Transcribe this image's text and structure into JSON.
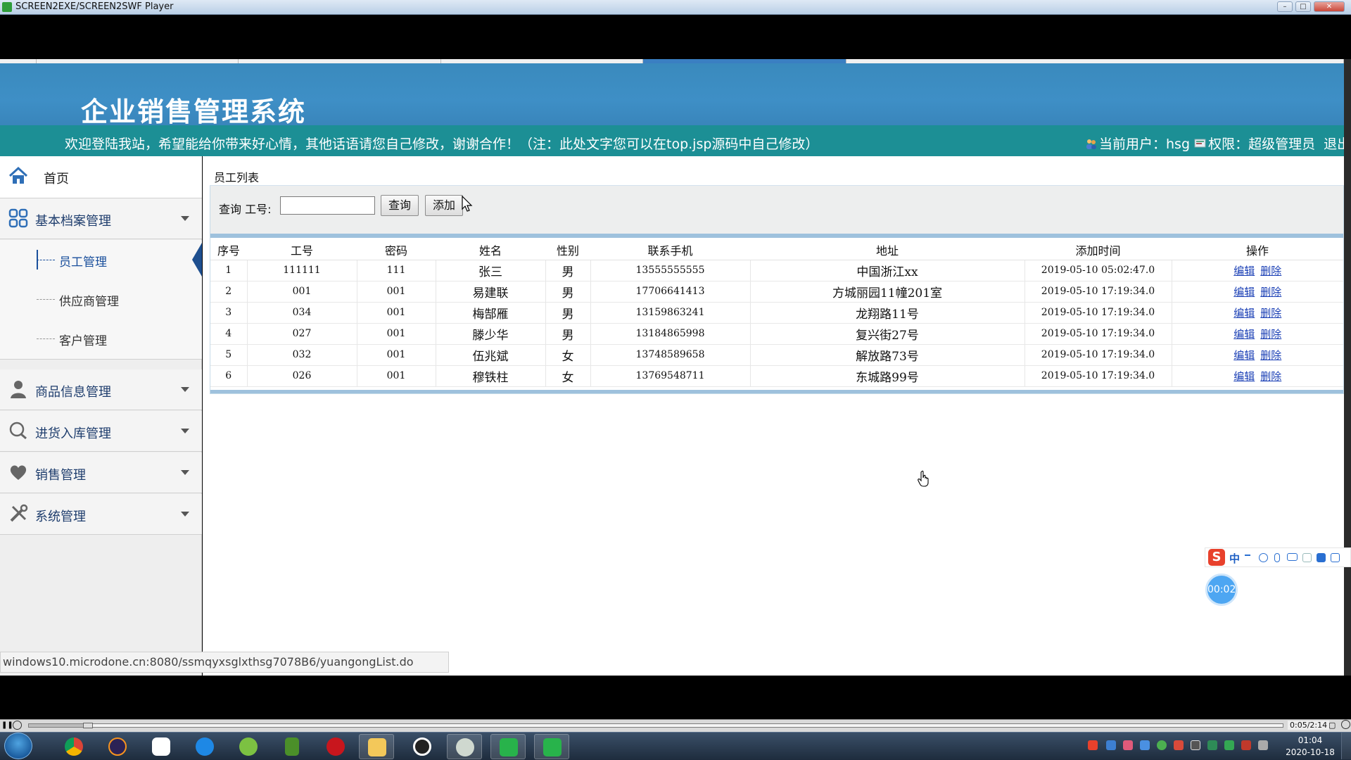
{
  "window": {
    "title": "SCREEN2EXE/SCREEN2SWF Player"
  },
  "app": {
    "title": "企业销售管理系统",
    "welcome": "欢迎登陆我站，希望能给你带来好心情，其他话语请您自己修改，谢谢合作！（注：此处文字您可以在top.jsp源码中自己修改）",
    "user_label": "当前用户：",
    "user_name": "hsg",
    "role_label": "权限：",
    "role_name": "超级管理员",
    "logout": "退出"
  },
  "sidebar": {
    "home": "首页",
    "groups": [
      {
        "label": "基本档案管理",
        "icon": "grid-icon"
      },
      {
        "label": "商品信息管理",
        "icon": "user-icon"
      },
      {
        "label": "进货入库管理",
        "icon": "chat-icon"
      },
      {
        "label": "销售管理",
        "icon": "heart-icon"
      },
      {
        "label": "系统管理",
        "icon": "tools-icon"
      }
    ],
    "subitems": [
      "员工管理",
      "供应商管理",
      "客户管理"
    ]
  },
  "panel": {
    "title": "员工列表",
    "search_label": "查询  工号:",
    "search_value": "",
    "query_button": "查询",
    "add_button": "添加"
  },
  "table": {
    "headers": [
      "序号",
      "工号",
      "密码",
      "姓名",
      "性别",
      "联系手机",
      "地址",
      "添加时间",
      "操作"
    ],
    "edit_label": "编辑",
    "delete_label": "删除",
    "rows": [
      [
        "1",
        "111111",
        "111",
        "张三",
        "男",
        "13555555555",
        "中国浙江xx",
        "2019-05-10 05:02:47.0"
      ],
      [
        "2",
        "001",
        "001",
        "易建联",
        "男",
        "17706641413",
        "方城丽园11幢201室",
        "2019-05-10 17:19:34.0"
      ],
      [
        "3",
        "034",
        "001",
        "梅郜雁",
        "男",
        "13159863241",
        "龙翔路11号",
        "2019-05-10 17:19:34.0"
      ],
      [
        "4",
        "027",
        "001",
        "滕少华",
        "男",
        "13184865998",
        "复兴街27号",
        "2019-05-10 17:19:34.0"
      ],
      [
        "5",
        "032",
        "001",
        "伍兆斌",
        "女",
        "13748589658",
        "解放路73号",
        "2019-05-10 17:19:34.0"
      ],
      [
        "6",
        "026",
        "001",
        "穆铁柱",
        "女",
        "13769548711",
        "东城路99号",
        "2019-05-10 17:19:34.0"
      ]
    ]
  },
  "statusbar": {
    "url": "windows10.microdone.cn:8080/ssmqyxsglxthsg7078B6/yuangongList.do"
  },
  "ime": {
    "lang": "中"
  },
  "timer": "00:02",
  "player": {
    "time": "0:05/2:14"
  },
  "taskbar": {
    "time": "01:04",
    "date": "2020-10-18"
  },
  "colors": {
    "header_blue": "#3e8fc6",
    "welcome_teal": "#1c8f95",
    "link_blue": "#1a3fb5",
    "sidebar_text": "#1e3d6d"
  }
}
